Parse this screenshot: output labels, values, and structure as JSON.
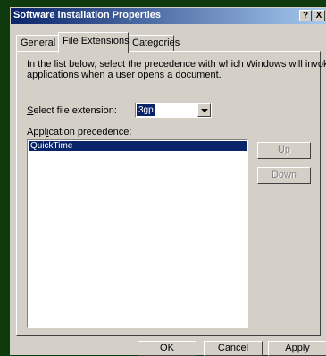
{
  "window": {
    "title": "Software installation Properties",
    "help_glyph": "?",
    "close_glyph": "X"
  },
  "tabs": [
    {
      "label": "General",
      "active": false
    },
    {
      "label": "File Extensions",
      "active": true
    },
    {
      "label": "Categories",
      "active": false
    }
  ],
  "panel": {
    "description_line1": "In the list below, select the precedence with which Windows will invoke",
    "description_line2": "applications when a user opens a document.",
    "select_label_mnemonic": "S",
    "select_label_rest": "elect file extension:",
    "selected_extension": "3gp",
    "precedence_label_pre": "Appl",
    "precedence_label_mnemonic": "i",
    "precedence_label_post": "cation precedence:",
    "applications": [
      "QuickTime"
    ],
    "up_button": "Up",
    "down_button": "Down"
  },
  "footer": {
    "ok": "OK",
    "cancel": "Cancel",
    "apply_mnemonic": "A",
    "apply_rest": "pply"
  },
  "colors": {
    "desktop": "#0e3a0e",
    "title_gradient_start": "#0a246a",
    "face": "#d4d0c8",
    "selection": "#0a246a"
  }
}
